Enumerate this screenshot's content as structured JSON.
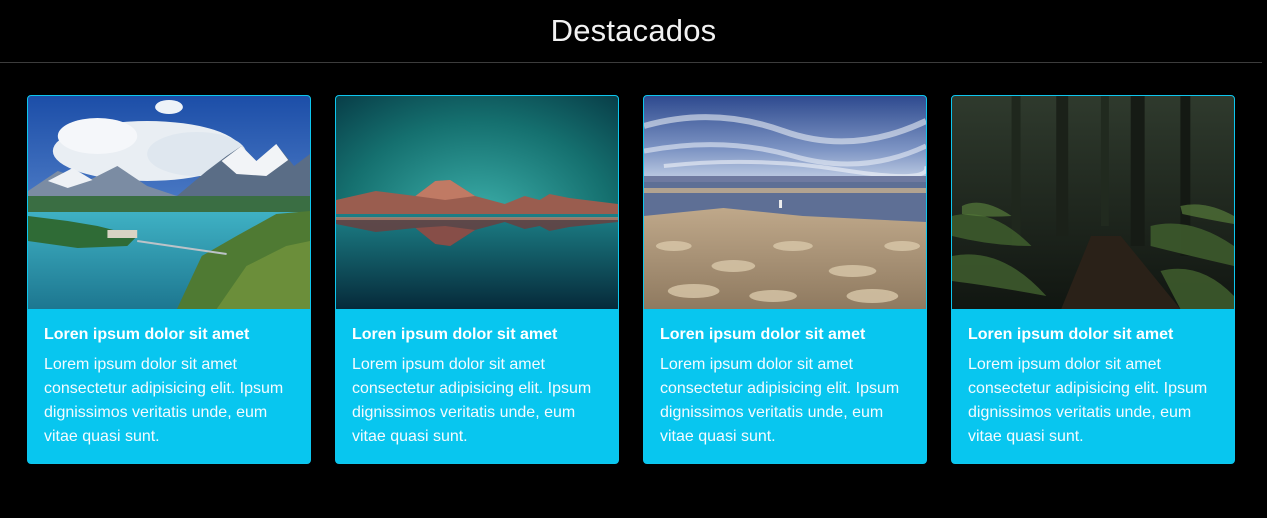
{
  "section": {
    "title": "Destacados"
  },
  "cards": [
    {
      "image_alt": "mountain-lake-icon",
      "title": "Loren ipsum dolor sit amet",
      "text": "Lorem ipsum dolor sit amet consectetur adipisicing elit. Ipsum dignissimos veritatis unde, eum vitae quasi sunt."
    },
    {
      "image_alt": "mountain-reflection-icon",
      "title": "Loren ipsum dolor sit amet",
      "text": "Lorem ipsum dolor sit amet consectetur adipisicing elit. Ipsum dignissimos veritatis unde, eum vitae quasi sunt."
    },
    {
      "image_alt": "salt-flat-icon",
      "title": "Loren ipsum dolor sit amet",
      "text": "Lorem ipsum dolor sit amet consectetur adipisicing elit. Ipsum dignissimos veritatis unde, eum vitae quasi sunt."
    },
    {
      "image_alt": "forest-path-icon",
      "title": "Loren ipsum dolor sit amet",
      "text": "Lorem ipsum dolor sit amet consectetur adipisicing elit. Ipsum dignissimos veritatis unde, eum vitae quasi sunt."
    }
  ],
  "colors": {
    "background": "#000000",
    "card": "#08c6ef",
    "title_text": "#f2f2f2",
    "divider": "#3c3c3c"
  }
}
